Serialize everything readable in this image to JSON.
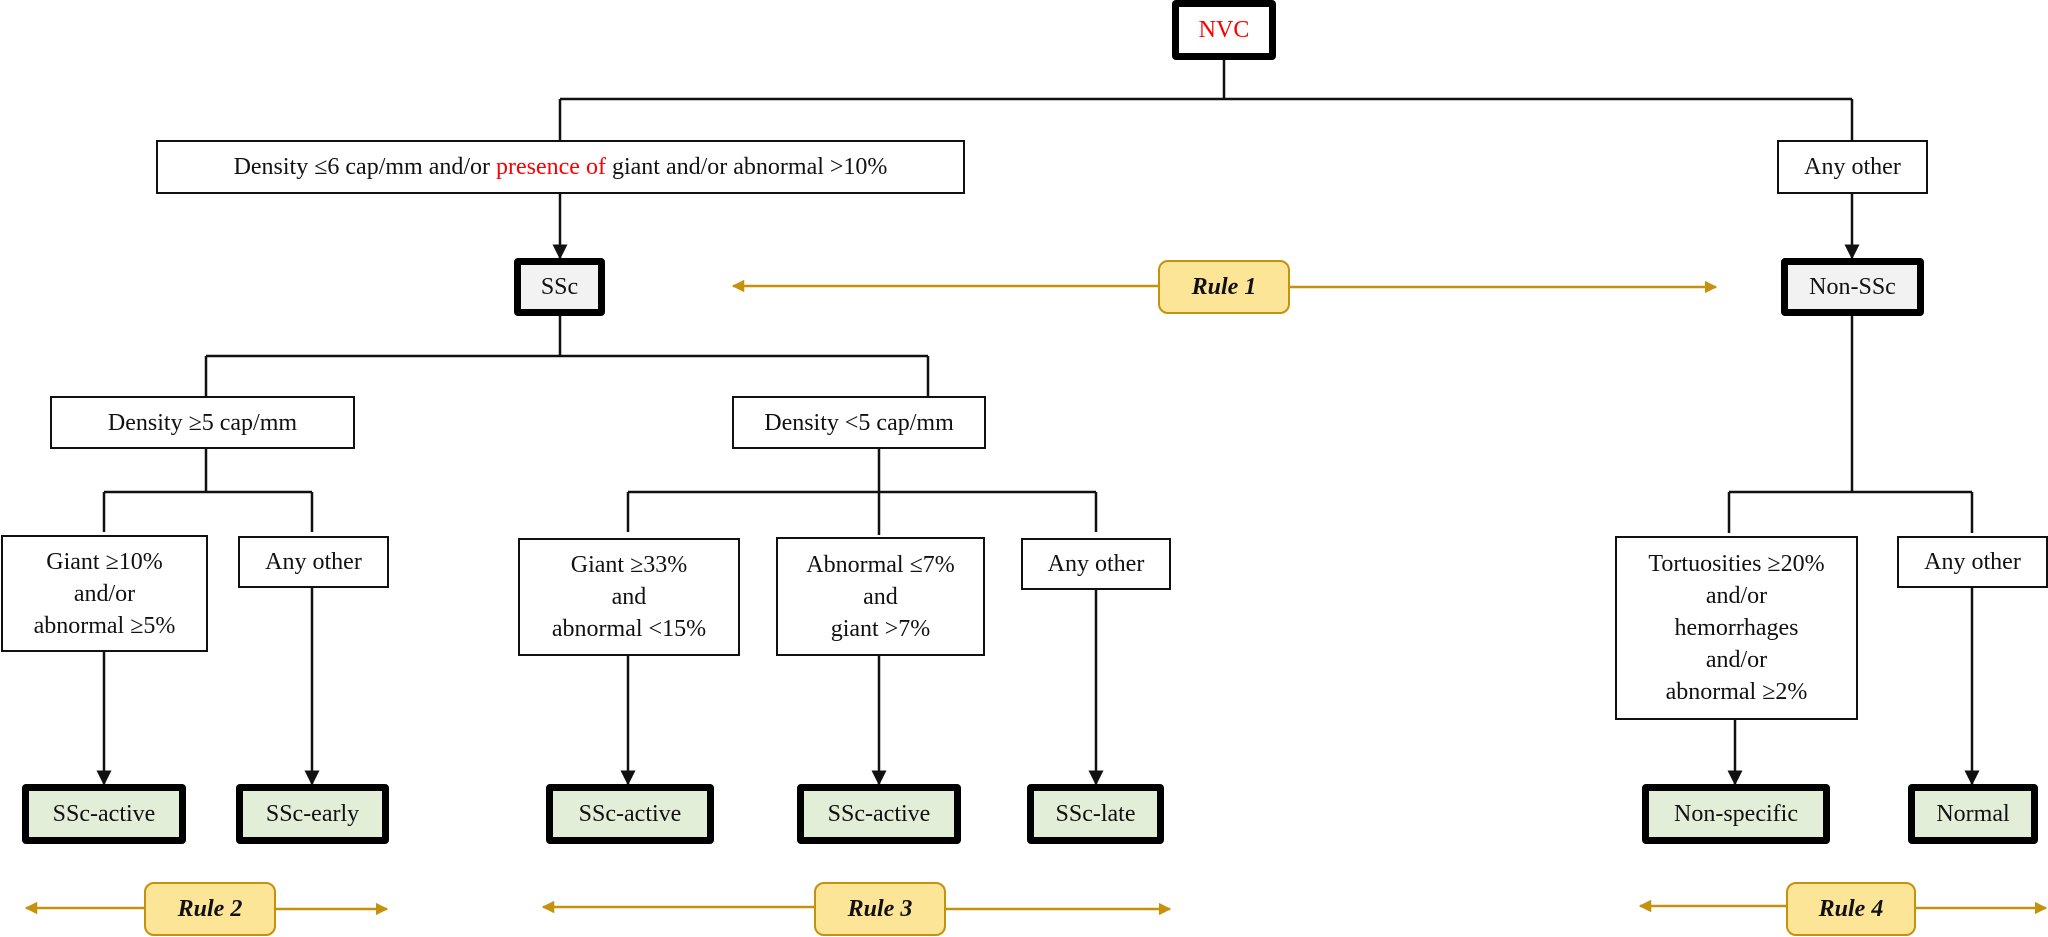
{
  "root": {
    "label": "NVC"
  },
  "level1": {
    "left": {
      "parts": [
        "Density ≤6 cap/mm and/or ",
        "presence of",
        " giant and/or abnormal >10%"
      ]
    },
    "right": {
      "label": "Any other"
    }
  },
  "level2": {
    "ssc": {
      "label": "SSc"
    },
    "non_ssc": {
      "label": "Non-SSc"
    }
  },
  "level3": {
    "density_ge5": {
      "label": "Density ≥5 cap/mm"
    },
    "density_lt5": {
      "label": "Density <5 cap/mm"
    }
  },
  "criteria": {
    "giant10": {
      "label": "Giant ≥10%\nand/or\nabnormal ≥5%"
    },
    "any_other_a": {
      "label": "Any other"
    },
    "giant33": {
      "label": "Giant ≥33%\nand\nabnormal <15%"
    },
    "abn7": {
      "label": "Abnormal ≤7%\nand\ngiant >7%"
    },
    "any_other_b": {
      "label": "Any other"
    },
    "tortuosities": {
      "label": "Tortuosities ≥20%\nand/or\nhemorrhages\nand/or\nabnormal ≥2%"
    },
    "any_other_c": {
      "label": "Any other"
    }
  },
  "outcomes": {
    "o1": {
      "label": "SSc-active"
    },
    "o2": {
      "label": "SSc-early"
    },
    "o3": {
      "label": "SSc-active"
    },
    "o4": {
      "label": "SSc-active"
    },
    "o5": {
      "label": "SSc-late"
    },
    "o6": {
      "label": "Non-specific"
    },
    "o7": {
      "label": "Normal"
    }
  },
  "rules": {
    "r1": {
      "label": "Rule 1"
    },
    "r2": {
      "label": "Rule 2"
    },
    "r3": {
      "label": "Rule 3"
    },
    "r4": {
      "label": "Rule 4"
    }
  },
  "colors": {
    "connector": "#111111",
    "rule_arrow": "#c4920c",
    "rule_fill": "#fde598",
    "leaf_fill": "#e2eed8",
    "highlight_text": "#ff0000"
  }
}
